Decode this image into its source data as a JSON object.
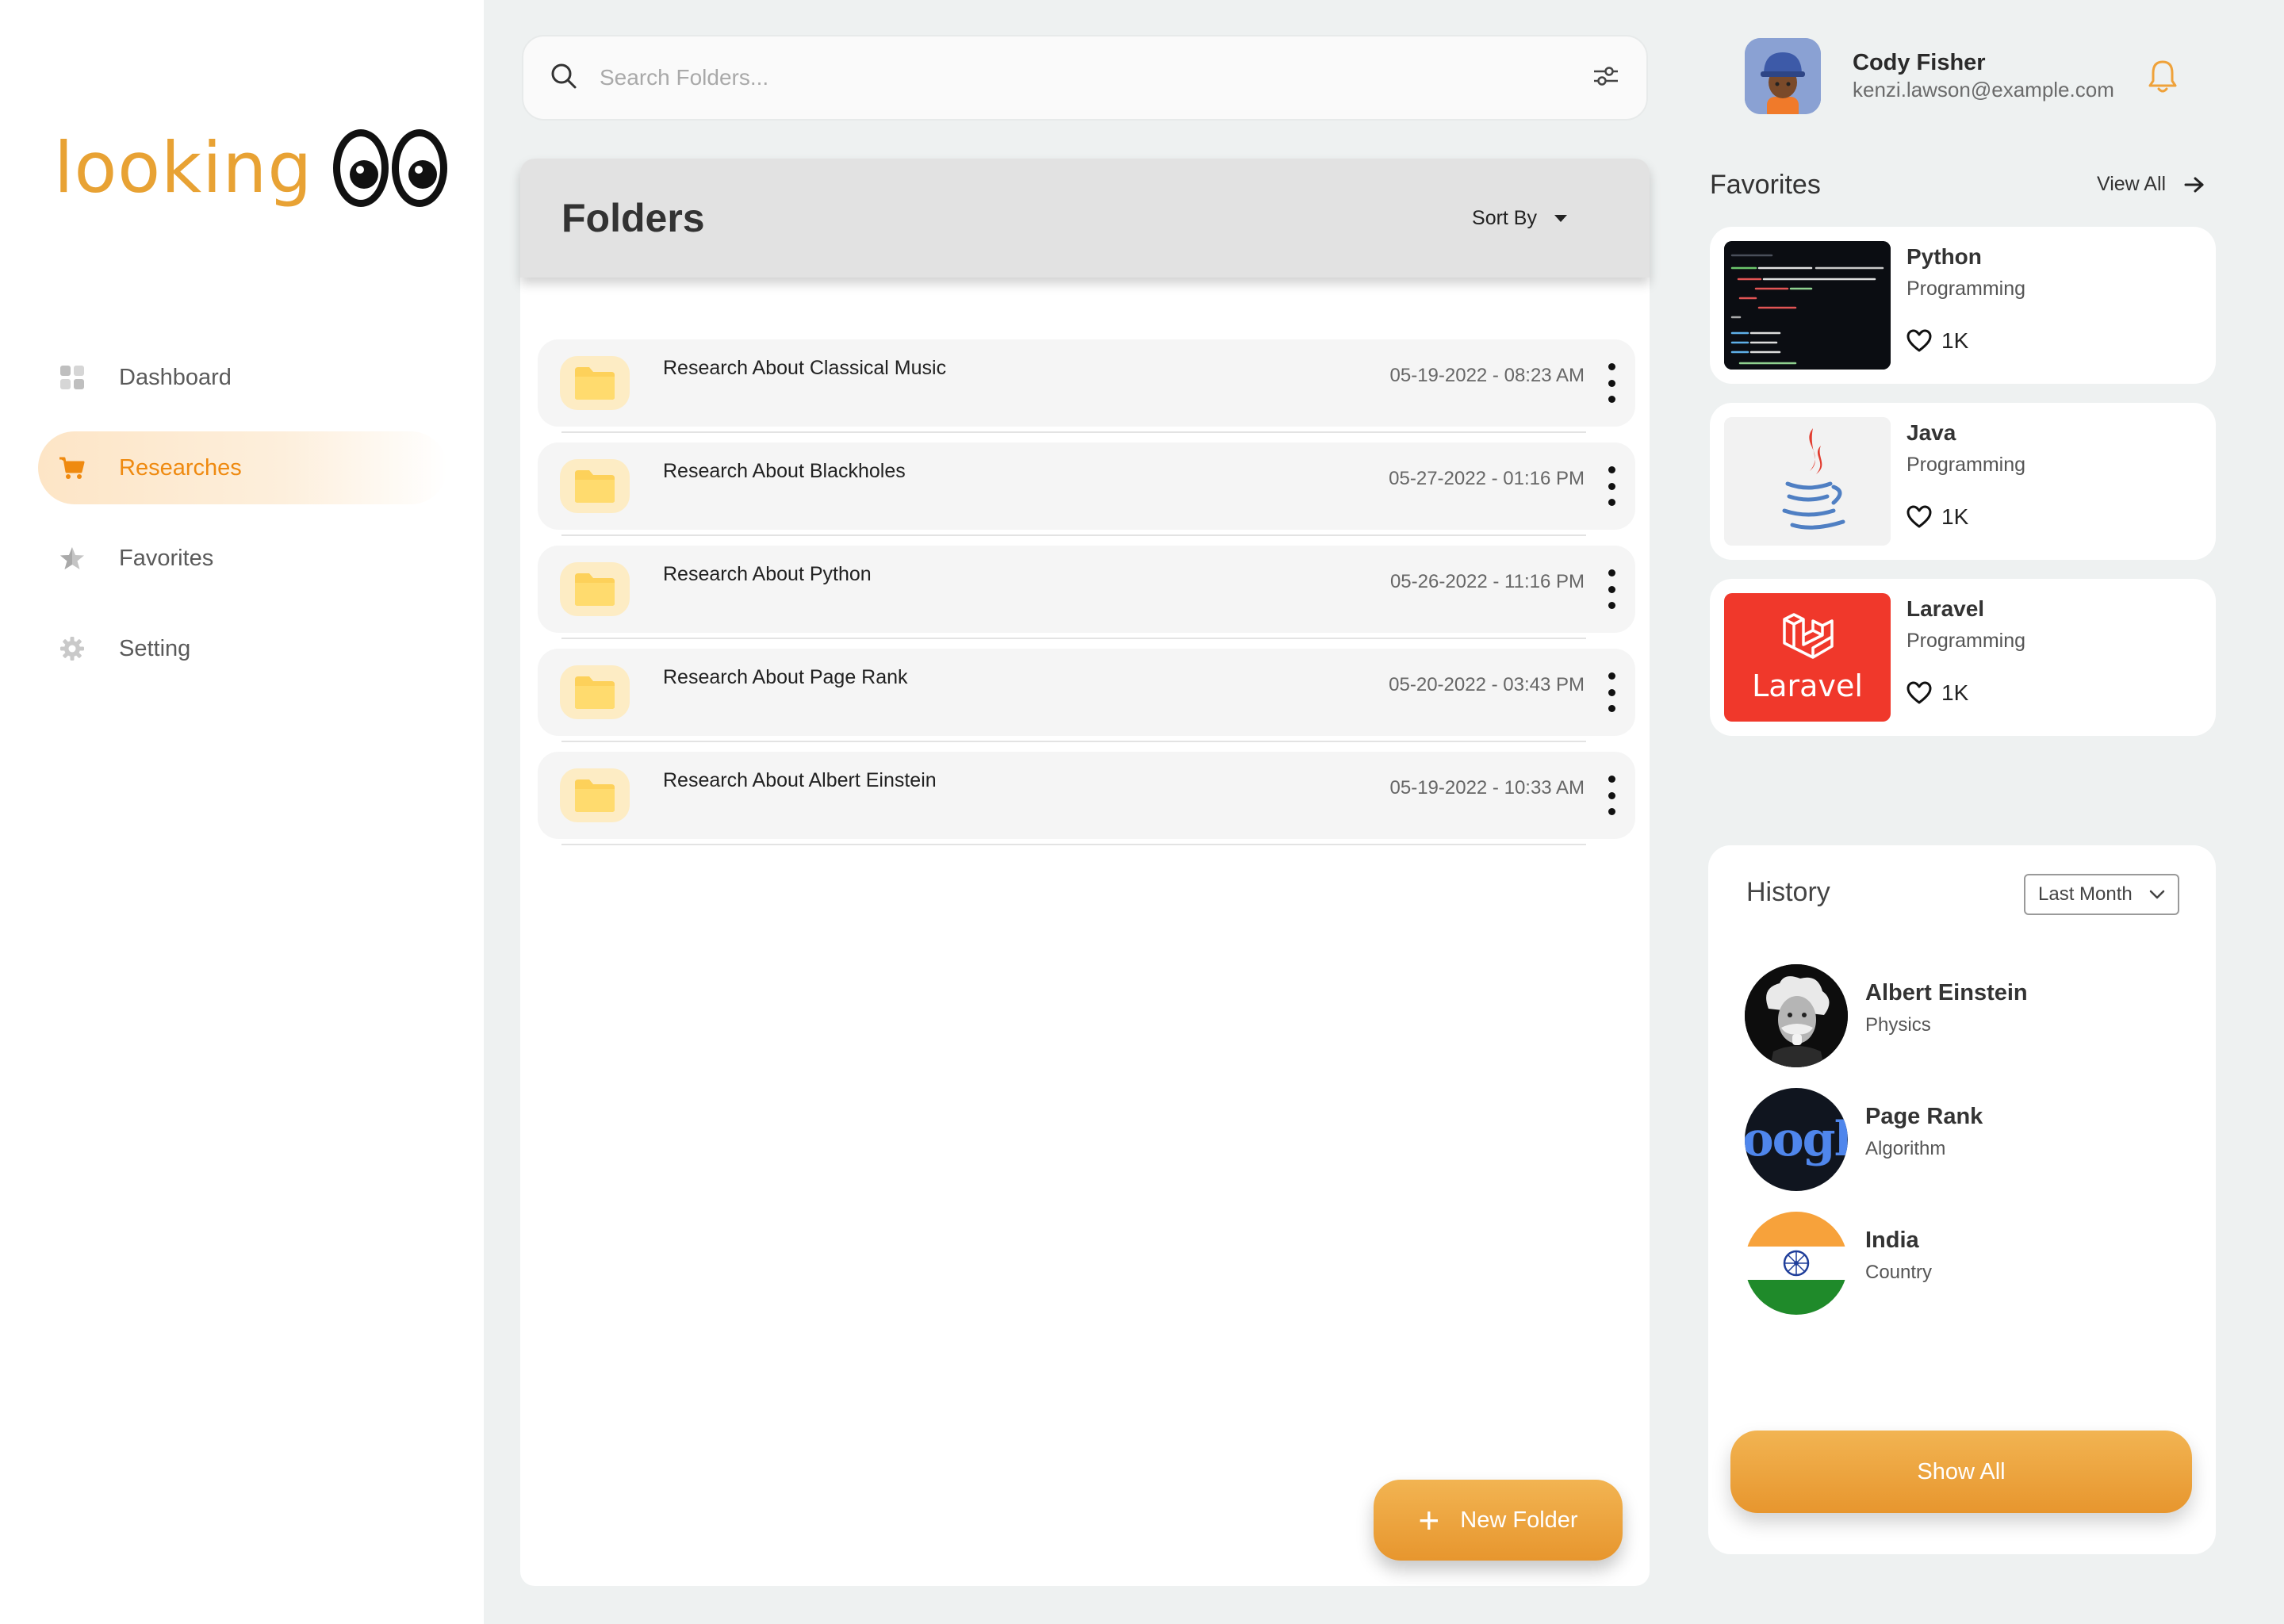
{
  "app": {
    "logo_text": "looking",
    "accent_color": "#e8a234",
    "active_color": "#ef8a10"
  },
  "sidebar": {
    "items": [
      {
        "label": "Dashboard",
        "icon": "grid-icon",
        "active": false
      },
      {
        "label": "Researches",
        "icon": "cart-icon",
        "active": true
      },
      {
        "label": "Favorites",
        "icon": "star-icon",
        "active": false
      },
      {
        "label": "Setting",
        "icon": "gear-icon",
        "active": false
      }
    ]
  },
  "search": {
    "placeholder": "Search Folders...",
    "value": ""
  },
  "folders": {
    "title": "Folders",
    "sort_label": "Sort By",
    "new_folder_label": "New Folder",
    "items": [
      {
        "name": "Research About Classical Music",
        "date": "05-19-2022 - 08:23 AM"
      },
      {
        "name": "Research About Blackholes",
        "date": "05-27-2022 - 01:16 PM"
      },
      {
        "name": "Research About Python",
        "date": "05-26-2022 - 11:16 PM"
      },
      {
        "name": "Research About Page Rank",
        "date": "05-20-2022 - 03:43 PM"
      },
      {
        "name": "Research About Albert Einstein",
        "date": "05-19-2022 - 10:33 AM"
      }
    ]
  },
  "profile": {
    "name": "Cody Fisher",
    "email": "kenzi.lawson@example.com"
  },
  "favorites": {
    "title": "Favorites",
    "view_all_label": "View All",
    "items": [
      {
        "name": "Python",
        "category": "Programming",
        "likes": "1K"
      },
      {
        "name": "Java",
        "category": "Programming",
        "likes": "1K"
      },
      {
        "name": "Laravel",
        "category": "Programming",
        "likes": "1K",
        "thumb_text": "Laravel"
      }
    ]
  },
  "history": {
    "title": "History",
    "filter_value": "Last Month",
    "show_all_label": "Show All",
    "items": [
      {
        "name": "Albert Einstein",
        "category": "Physics"
      },
      {
        "name": "Page Rank",
        "category": "Algorithm",
        "thumb_text": "oogl"
      },
      {
        "name": "India",
        "category": "Country"
      }
    ]
  }
}
